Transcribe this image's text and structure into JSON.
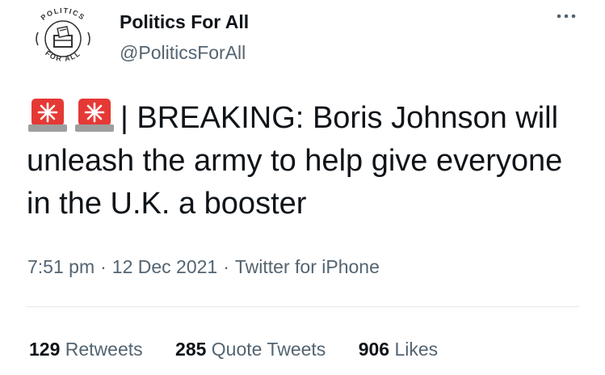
{
  "account": {
    "display_name": "Politics For All",
    "handle": "@PoliticsForAll",
    "avatar_text_top": "POLITICS",
    "avatar_text_bottom": "FOR ALL"
  },
  "tweet": {
    "emoji_icons": [
      "police-light-icon",
      "police-light-icon"
    ],
    "prefix": "| BREAKING: ",
    "text": "Boris Johnson will unleash the army to help give everyone in the U.K. a booster",
    "time": "7:51 pm",
    "date": "12 Dec 2021",
    "source": "Twitter for iPhone",
    "separator": "·"
  },
  "stats": {
    "retweets_count": "129",
    "retweets_label": "Retweets",
    "quotes_count": "285",
    "quotes_label": "Quote Tweets",
    "likes_count": "906",
    "likes_label": "Likes"
  },
  "colors": {
    "primary_text": "#0f1419",
    "secondary_text": "#536471",
    "divider": "#e6e9eb",
    "siren_red": "#e53935"
  }
}
